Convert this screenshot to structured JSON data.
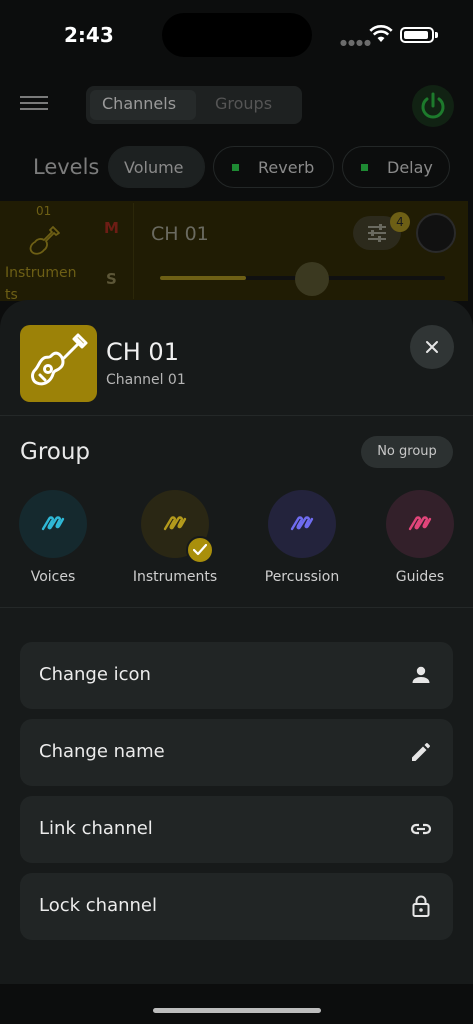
{
  "status_bar": {
    "time": "2:43"
  },
  "header": {
    "tabs": [
      {
        "label": "Channels",
        "active": true
      },
      {
        "label": "Groups",
        "active": false
      }
    ]
  },
  "levels": {
    "title": "Levels",
    "pills": [
      {
        "label": "Volume",
        "active": true
      },
      {
        "label": "Reverb",
        "indicator": "#1e8a33"
      },
      {
        "label": "Delay",
        "indicator": "#1e8a33"
      }
    ]
  },
  "background_channel": {
    "number": "01",
    "icon": "guitar-icon",
    "group_label_line1": "Instrumen",
    "group_label_line2": "ts",
    "mute_label": "M",
    "solo_label": "S",
    "name": "CH 01",
    "eq_badge": "4",
    "fader_level": 0.3
  },
  "sheet": {
    "title": "CH 01",
    "subtitle": "Channel 01",
    "avatar_icon": "guitar-icon",
    "avatar_color": "#9c8208",
    "close_icon": "close-icon",
    "group_title": "Group",
    "no_group_label": "No group",
    "groups": [
      {
        "label": "Voices",
        "color": "#2fb8d6",
        "bg": "#15292e",
        "selected": false
      },
      {
        "label": "Instruments",
        "color": "#b39a1c",
        "bg": "#2a2714",
        "selected": true
      },
      {
        "label": "Percussion",
        "color": "#6f6cf0",
        "bg": "#23233c",
        "selected": false
      },
      {
        "label": "Guides",
        "color": "#e0457a",
        "bg": "#33202a",
        "selected": false
      }
    ],
    "actions": [
      {
        "label": "Change icon",
        "icon": "person-icon"
      },
      {
        "label": "Change name",
        "icon": "pencil-icon"
      },
      {
        "label": "Link channel",
        "icon": "link-icon"
      },
      {
        "label": "Lock channel",
        "icon": "lock-icon"
      }
    ]
  }
}
